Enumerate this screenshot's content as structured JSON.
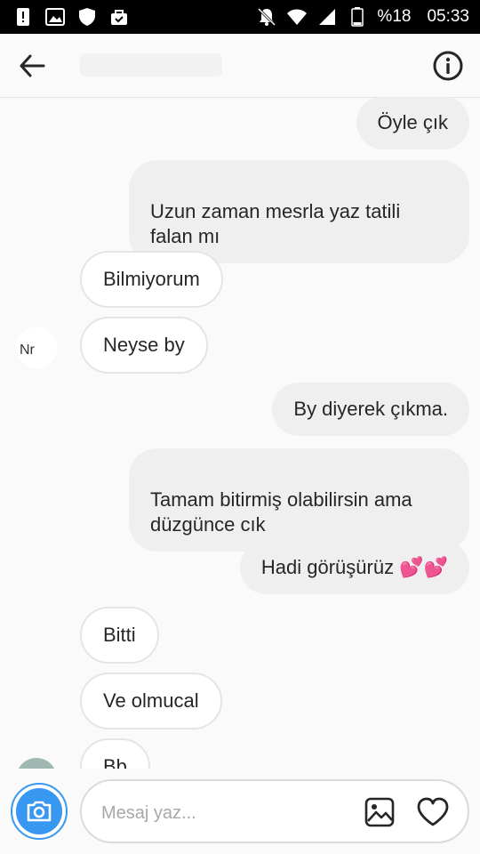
{
  "status_bar": {
    "battery_percent": "%18",
    "time": "05:33"
  },
  "messages": [
    {
      "side": "out",
      "text": "Öyle çık"
    },
    {
      "side": "out",
      "text": "Uzun zaman mesrla yaz tatili\nfalan mı"
    },
    {
      "side": "in",
      "text": "Bilmiyorum"
    },
    {
      "side": "in",
      "text": "Neyse by"
    },
    {
      "side": "out",
      "text": "By diyerek çıkma."
    },
    {
      "side": "out",
      "text": "Tamam bitirmiş olabilirsin ama\ndüzgünce cık"
    },
    {
      "side": "out",
      "text": "Hadi görüşürüz 💕💕"
    },
    {
      "side": "in",
      "text": "Bitti"
    },
    {
      "side": "in",
      "text": "Ve olmucal"
    },
    {
      "side": "in",
      "text": "Bb"
    }
  ],
  "composer": {
    "placeholder": "Mesaj yaz..."
  },
  "colors": {
    "accent": "#3897f0",
    "outgoing_bubble": "#efefef",
    "incoming_border": "#e5e5e5"
  }
}
